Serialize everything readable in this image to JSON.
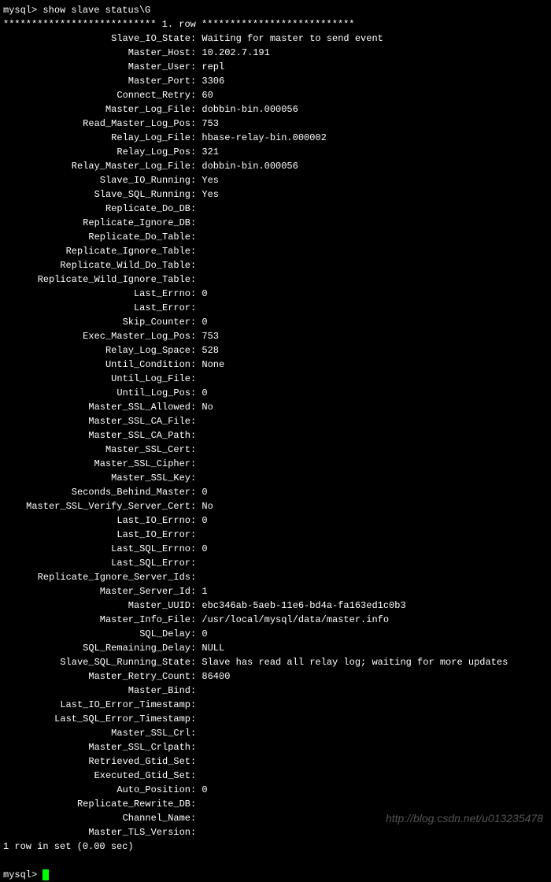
{
  "prompt": "mysql> ",
  "command": "show slave status\\G",
  "row_header_left": "*************************** ",
  "row_header_mid": "1. row",
  "row_header_right": " ***************************",
  "fields": [
    {
      "label": "Slave_IO_State",
      "value": "Waiting for master to send event"
    },
    {
      "label": "Master_Host",
      "value": "10.202.7.191"
    },
    {
      "label": "Master_User",
      "value": "repl"
    },
    {
      "label": "Master_Port",
      "value": "3306"
    },
    {
      "label": "Connect_Retry",
      "value": "60"
    },
    {
      "label": "Master_Log_File",
      "value": "dobbin-bin.000056"
    },
    {
      "label": "Read_Master_Log_Pos",
      "value": "753"
    },
    {
      "label": "Relay_Log_File",
      "value": "hbase-relay-bin.000002"
    },
    {
      "label": "Relay_Log_Pos",
      "value": "321"
    },
    {
      "label": "Relay_Master_Log_File",
      "value": "dobbin-bin.000056"
    },
    {
      "label": "Slave_IO_Running",
      "value": "Yes"
    },
    {
      "label": "Slave_SQL_Running",
      "value": "Yes"
    },
    {
      "label": "Replicate_Do_DB",
      "value": ""
    },
    {
      "label": "Replicate_Ignore_DB",
      "value": ""
    },
    {
      "label": "Replicate_Do_Table",
      "value": ""
    },
    {
      "label": "Replicate_Ignore_Table",
      "value": ""
    },
    {
      "label": "Replicate_Wild_Do_Table",
      "value": ""
    },
    {
      "label": "Replicate_Wild_Ignore_Table",
      "value": ""
    },
    {
      "label": "Last_Errno",
      "value": "0"
    },
    {
      "label": "Last_Error",
      "value": ""
    },
    {
      "label": "Skip_Counter",
      "value": "0"
    },
    {
      "label": "Exec_Master_Log_Pos",
      "value": "753"
    },
    {
      "label": "Relay_Log_Space",
      "value": "528"
    },
    {
      "label": "Until_Condition",
      "value": "None"
    },
    {
      "label": "Until_Log_File",
      "value": ""
    },
    {
      "label": "Until_Log_Pos",
      "value": "0"
    },
    {
      "label": "Master_SSL_Allowed",
      "value": "No"
    },
    {
      "label": "Master_SSL_CA_File",
      "value": ""
    },
    {
      "label": "Master_SSL_CA_Path",
      "value": ""
    },
    {
      "label": "Master_SSL_Cert",
      "value": ""
    },
    {
      "label": "Master_SSL_Cipher",
      "value": ""
    },
    {
      "label": "Master_SSL_Key",
      "value": ""
    },
    {
      "label": "Seconds_Behind_Master",
      "value": "0"
    },
    {
      "label": "Master_SSL_Verify_Server_Cert",
      "value": "No"
    },
    {
      "label": "Last_IO_Errno",
      "value": "0"
    },
    {
      "label": "Last_IO_Error",
      "value": ""
    },
    {
      "label": "Last_SQL_Errno",
      "value": "0"
    },
    {
      "label": "Last_SQL_Error",
      "value": ""
    },
    {
      "label": "Replicate_Ignore_Server_Ids",
      "value": ""
    },
    {
      "label": "Master_Server_Id",
      "value": "1"
    },
    {
      "label": "Master_UUID",
      "value": "ebc346ab-5aeb-11e6-bd4a-fa163ed1c0b3"
    },
    {
      "label": "Master_Info_File",
      "value": "/usr/local/mysql/data/master.info"
    },
    {
      "label": "SQL_Delay",
      "value": "0"
    },
    {
      "label": "SQL_Remaining_Delay",
      "value": "NULL"
    },
    {
      "label": "Slave_SQL_Running_State",
      "value": "Slave has read all relay log; waiting for more updates"
    },
    {
      "label": "Master_Retry_Count",
      "value": "86400"
    },
    {
      "label": "Master_Bind",
      "value": ""
    },
    {
      "label": "Last_IO_Error_Timestamp",
      "value": ""
    },
    {
      "label": "Last_SQL_Error_Timestamp",
      "value": ""
    },
    {
      "label": "Master_SSL_Crl",
      "value": ""
    },
    {
      "label": "Master_SSL_Crlpath",
      "value": ""
    },
    {
      "label": "Retrieved_Gtid_Set",
      "value": ""
    },
    {
      "label": "Executed_Gtid_Set",
      "value": ""
    },
    {
      "label": "Auto_Position",
      "value": "0"
    },
    {
      "label": "Replicate_Rewrite_DB",
      "value": ""
    },
    {
      "label": "Channel_Name",
      "value": ""
    },
    {
      "label": "Master_TLS_Version",
      "value": ""
    }
  ],
  "footer": "1 row in set (0.00 sec)",
  "watermark": "http://blog.csdn.net/u013235478"
}
